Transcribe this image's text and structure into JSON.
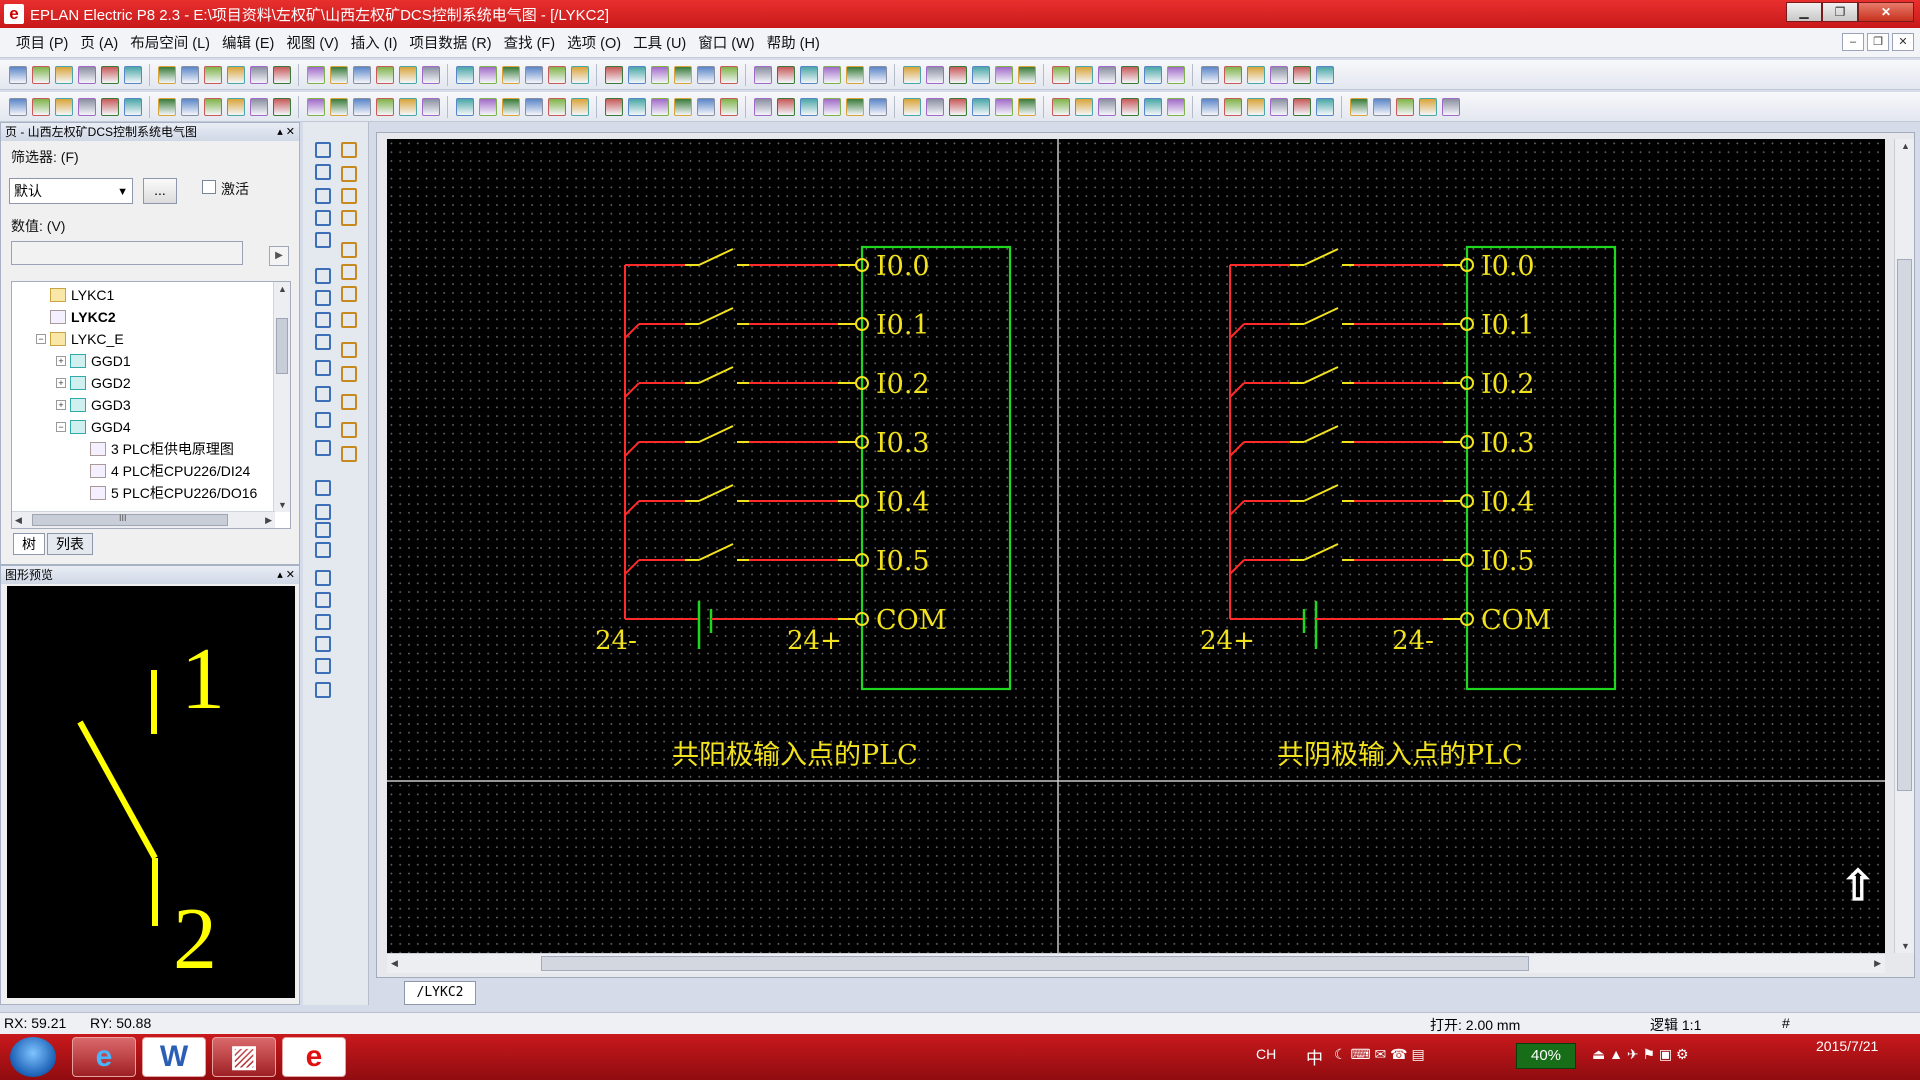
{
  "window": {
    "app_letter": "e",
    "title": "EPLAN Electric P8 2.3 - E:\\项目资料\\左权矿\\山西左权矿DCS控制系统电气图 - [/LYKC2]",
    "buttons": {
      "minimize": "▁",
      "maximize": "❐",
      "close": "✕"
    }
  },
  "menu": {
    "items": [
      "项目 (P)",
      "页 (A)",
      "布局空间 (L)",
      "编辑 (E)",
      "视图 (V)",
      "插入 (I)",
      "项目数据 (R)",
      "查找 (F)",
      "选项 (O)",
      "工具 (U)",
      "窗口 (W)",
      "帮助 (H)"
    ],
    "mdi_buttons": {
      "minimize": "–",
      "restore": "❐",
      "close": "✕"
    }
  },
  "page_nav": {
    "header": "页 - 山西左权矿DCS控制系统电气图",
    "filter_label": "筛选器: (F)",
    "filter_value": "默认",
    "filter_more": "...",
    "activate_label": "激活",
    "value_label": "数值: (V)",
    "value_input": "",
    "tree": [
      {
        "label": "LYKC1",
        "level": 1,
        "icon": "folder",
        "expand": ""
      },
      {
        "label": "LYKC2",
        "level": 1,
        "icon": "doc",
        "expand": "",
        "bold": true
      },
      {
        "label": "LYKC_E",
        "level": 1,
        "icon": "folder",
        "expand": "−"
      },
      {
        "label": "GGD1",
        "level": 2,
        "icon": "grp",
        "expand": "+"
      },
      {
        "label": "GGD2",
        "level": 2,
        "icon": "grp",
        "expand": "+"
      },
      {
        "label": "GGD3",
        "level": 2,
        "icon": "grp",
        "expand": "+"
      },
      {
        "label": "GGD4",
        "level": 2,
        "icon": "grp",
        "expand": "−"
      },
      {
        "label": "3 PLC柜供电原理图",
        "level": 3,
        "icon": "doc",
        "expand": ""
      },
      {
        "label": "4 PLC柜CPU226/DI24",
        "level": 3,
        "icon": "doc",
        "expand": ""
      },
      {
        "label": "5 PLC柜CPU226/DO16",
        "level": 3,
        "icon": "doc",
        "expand": ""
      }
    ],
    "tabs": [
      "树",
      "列表"
    ],
    "scroll_grip": "III"
  },
  "preview": {
    "header": "图形预览",
    "pin_label_top": "1",
    "pin_label_bottom": "2"
  },
  "drawing": {
    "left_circuit": {
      "inputs": [
        "I0.0",
        "I0.1",
        "I0.2",
        "I0.3",
        "I0.4",
        "I0.5"
      ],
      "com_label": "COM",
      "supply_left": "24-",
      "supply_right": "24+",
      "caption": "共阳极输入点的PLC"
    },
    "right_circuit": {
      "inputs": [
        "I0.0",
        "I0.1",
        "I0.2",
        "I0.3",
        "I0.4",
        "I0.5"
      ],
      "com_label": "COM",
      "supply_left": "24+",
      "supply_right": "24-",
      "caption": "共阴极输入点的PLC"
    },
    "colors": {
      "background": "#000000",
      "wire": "#ff2a2a",
      "component": "#f2e21e",
      "plc_box": "#1ed81e",
      "border": "#c8c8c8"
    },
    "page_tab": "/LYKC2",
    "home_icon": "⇧"
  },
  "status": {
    "rx": "RX: 59.21",
    "ry": "RY: 50.88",
    "snap": "打开: 2.00 mm",
    "scale": "逻辑 1:1",
    "hash": "#"
  },
  "taskbar": {
    "apps": [
      "e",
      "W",
      "e"
    ],
    "tray_lang": "CH",
    "tray_ime": "中",
    "battery": "40%",
    "date": "2015/7/21"
  }
}
